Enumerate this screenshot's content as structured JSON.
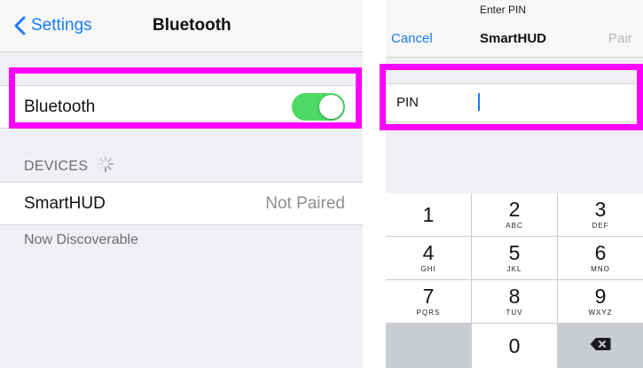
{
  "settings_screen": {
    "back_label": "Settings",
    "title": "Bluetooth",
    "bluetooth_row_label": "Bluetooth",
    "bluetooth_enabled": true,
    "devices_header": "DEVICES",
    "device": {
      "name": "SmartHUD",
      "status": "Not Paired"
    },
    "footer_text": "Now Discoverable"
  },
  "pin_screen": {
    "prompt": "Enter PIN",
    "cancel_label": "Cancel",
    "title": "SmartHUD",
    "pair_label": "Pair",
    "pin_label": "PIN",
    "pin_value": ""
  },
  "keypad": {
    "keys": [
      {
        "number": "1",
        "letters": ""
      },
      {
        "number": "2",
        "letters": "ABC"
      },
      {
        "number": "3",
        "letters": "DEF"
      },
      {
        "number": "4",
        "letters": "GHI"
      },
      {
        "number": "5",
        "letters": "JKL"
      },
      {
        "number": "6",
        "letters": "MNO"
      },
      {
        "number": "7",
        "letters": "PQRS"
      },
      {
        "number": "8",
        "letters": "TUV"
      },
      {
        "number": "9",
        "letters": "WXYZ"
      },
      {
        "number": "0",
        "letters": ""
      }
    ]
  },
  "colors": {
    "accent": "#1a7cf5",
    "toggle_on": "#4cd964",
    "highlight": "#ff00ff",
    "group_background": "#efeff4"
  },
  "icons": {
    "back": "chevron-left-icon",
    "scanning": "activity-spinner-icon",
    "delete": "backspace-icon"
  }
}
